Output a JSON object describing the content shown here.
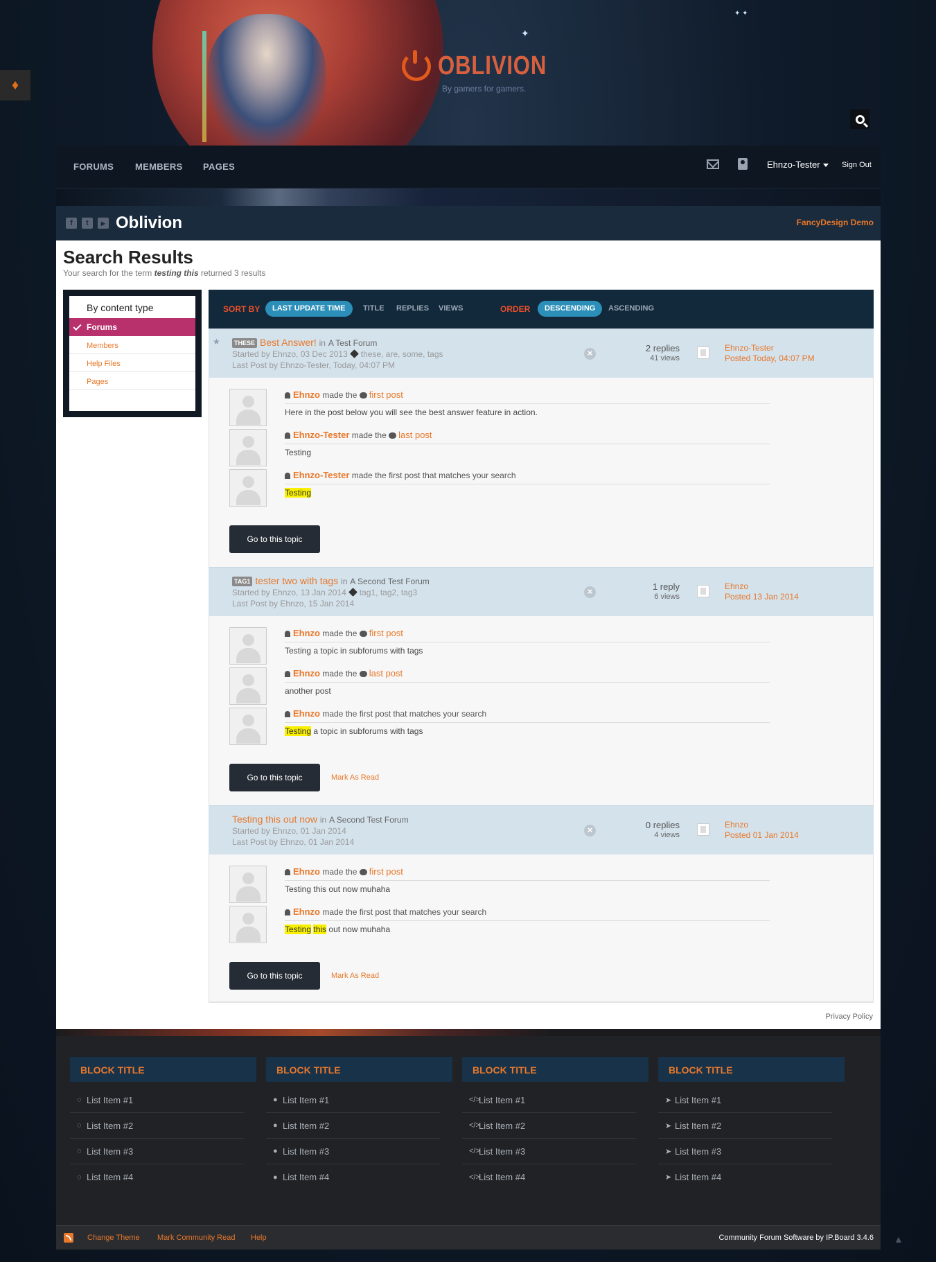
{
  "header": {
    "logo_text": "OBLIVION",
    "tagline": "By gamers for gamers."
  },
  "nav": {
    "items": [
      "FORUMS",
      "MEMBERS",
      "PAGES"
    ],
    "username": "Ehnzo-Tester",
    "sign_out": "Sign Out"
  },
  "brand": {
    "social": [
      "f",
      "t",
      "▶"
    ],
    "title": "Oblivion",
    "right_link": "FancyDesign Demo"
  },
  "page": {
    "title": "Search Results",
    "sub_prefix": "Your search for the term",
    "sub_term": "testing this",
    "sub_suffix": "returned 3 results"
  },
  "filter": {
    "heading": "By content type",
    "items": [
      "Forums",
      "Members",
      "Help Files",
      "Pages"
    ],
    "active": "Forums"
  },
  "sortbar": {
    "sort_by_label": "SORT BY",
    "sort_options": [
      "LAST UPDATE TIME",
      "TITLE",
      "REPLIES",
      "VIEWS"
    ],
    "order_label": "ORDER",
    "order_options": [
      "DESCENDING",
      "ASCENDING"
    ]
  },
  "topics": [
    {
      "tag": "THESE",
      "title": "Best Answer!",
      "in_text": "in",
      "forum": "A Test Forum",
      "started": "Started by Ehnzo, 03 Dec 2013",
      "tags": "these, are, some, tags",
      "last_post": "Last Post by Ehnzo-Tester, Today, 04:07 PM",
      "replies": "2 replies",
      "views": "41 views",
      "last_author": "Ehnzo-Tester",
      "last_posted": "Posted Today, 04:07 PM",
      "posts": [
        {
          "author": "Ehnzo",
          "made": "made the",
          "link": "first post",
          "text_hl": "",
          "text": "Here in the post below you will see the best answer feature in action."
        },
        {
          "author": "Ehnzo-Tester",
          "made": "made the",
          "link": "last post",
          "text_hl": "",
          "text": "Testing"
        },
        {
          "author": "Ehnzo-Tester",
          "made": "made the first post that matches your search",
          "link": "",
          "text_hl": "Testing",
          "text": ""
        }
      ],
      "go_button": "Go to this topic",
      "mark_read": ""
    },
    {
      "tag": "TAG1",
      "title": "tester two with tags",
      "in_text": "in",
      "forum": "A Second Test Forum",
      "started": "Started by Ehnzo, 13 Jan 2014",
      "tags": "tag1, tag2, tag3",
      "last_post": "Last Post by Ehnzo, 15 Jan 2014",
      "replies": "1 reply",
      "views": "6 views",
      "last_author": "Ehnzo",
      "last_posted": "Posted 13 Jan 2014",
      "posts": [
        {
          "author": "Ehnzo",
          "made": "made the",
          "link": "first post",
          "text_hl": "",
          "text": "Testing a topic in subforums with tags"
        },
        {
          "author": "Ehnzo",
          "made": "made the",
          "link": "last post",
          "text_hl": "",
          "text": "another post"
        },
        {
          "author": "Ehnzo",
          "made": "made the first post that matches your search",
          "link": "",
          "text_hl": "Testing",
          "text": " a topic in subforums with tags"
        }
      ],
      "go_button": "Go to this topic",
      "mark_read": "Mark As Read"
    },
    {
      "tag": "",
      "title": "Testing this out now",
      "in_text": "in",
      "forum": "A Second Test Forum",
      "started": "Started by Ehnzo, 01 Jan 2014",
      "tags": "",
      "last_post": "Last Post by Ehnzo, 01 Jan 2014",
      "replies": "0 replies",
      "views": "4 views",
      "last_author": "Ehnzo",
      "last_posted": "Posted 01 Jan 2014",
      "posts": [
        {
          "author": "Ehnzo",
          "made": "made the",
          "link": "first post",
          "text": "Testing this out now muhaha"
        },
        {
          "author": "Ehnzo",
          "made": "made the first post that matches your search",
          "link": "",
          "hl1": "Testing",
          "hl2": "this",
          "text": " out now muhaha"
        }
      ],
      "go_button": "Go to this topic",
      "mark_read": "Mark As Read"
    }
  ],
  "privacy": "Privacy Policy",
  "footer_blocks": [
    {
      "title": "BLOCK TITLE",
      "icon": "comment-outline-icon",
      "glyph": "◌",
      "items": [
        "List Item #1",
        "List Item #2",
        "List Item #3",
        "List Item #4"
      ]
    },
    {
      "title": "BLOCK TITLE",
      "icon": "comment-icon",
      "glyph": "●",
      "items": [
        "List Item #1",
        "List Item #2",
        "List Item #3",
        "List Item #4"
      ]
    },
    {
      "title": "BLOCK TITLE",
      "icon": "code-icon",
      "glyph": "</>",
      "items": [
        "List Item #1",
        "List Item #2",
        "List Item #3",
        "List Item #4"
      ]
    },
    {
      "title": "BLOCK TITLE",
      "icon": "location-arrow-icon",
      "glyph": "➤",
      "items": [
        "List Item #1",
        "List Item #2",
        "List Item #3",
        "List Item #4"
      ]
    }
  ],
  "bottom": {
    "links": [
      "Change Theme",
      "Mark Community Read",
      "Help"
    ],
    "copyright": "Community Forum Software by IP.Board 3.4.6"
  },
  "colors": {
    "accent": "#e8782a",
    "active_filter": "#b8316d",
    "pill": "#2c8fb9",
    "topic_head": "#d4e2ec",
    "highlight": "#f9f000"
  }
}
